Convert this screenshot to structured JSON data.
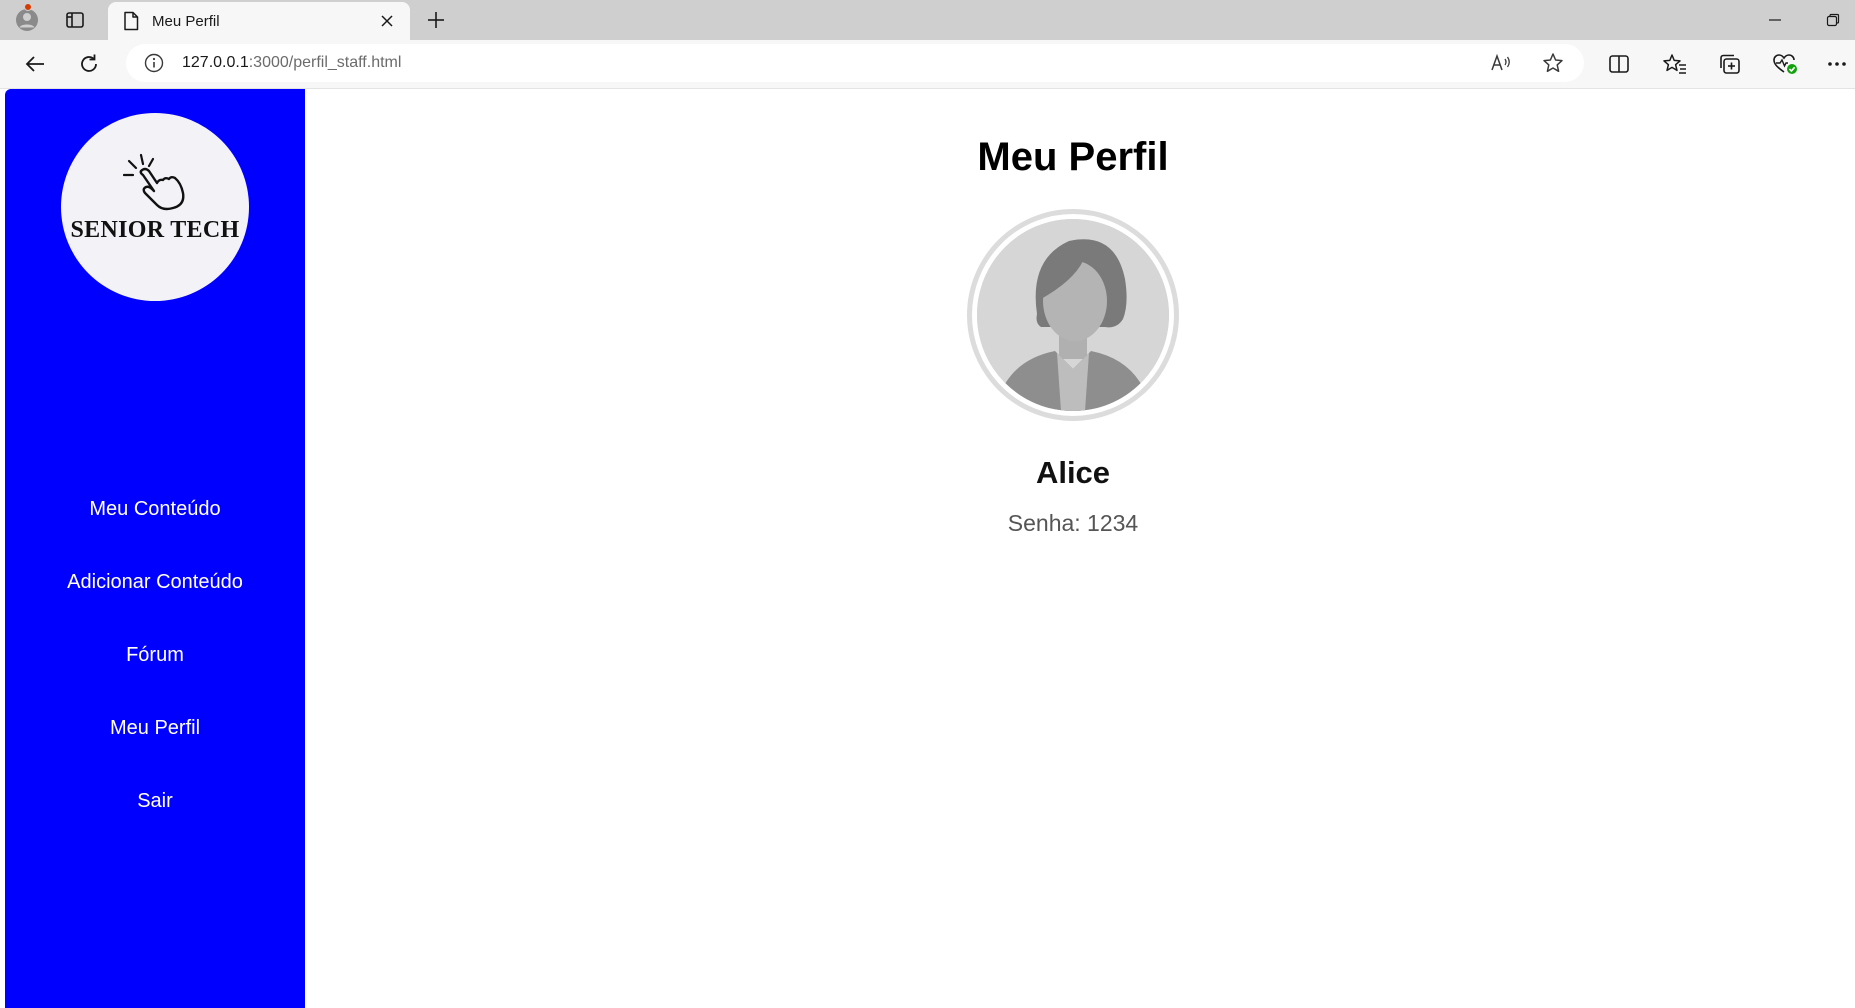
{
  "browser": {
    "tab": {
      "title": "Meu Perfil"
    },
    "address": {
      "host": "127.0.0.1",
      "path": ":3000/perfil_staff.html"
    }
  },
  "sidebar": {
    "logo_text": "SENIOR TECH",
    "nav": [
      {
        "label": "Meu Conteúdo"
      },
      {
        "label": "Adicionar Conteúdo"
      },
      {
        "label": "Fórum"
      },
      {
        "label": "Meu Perfil"
      },
      {
        "label": "Sair"
      }
    ]
  },
  "profile": {
    "title": "Meu Perfil",
    "name": "Alice",
    "password_line": "Senha: 1234"
  },
  "colors": {
    "sidebar": "#0000ff",
    "tabstrip": "#cfcfcf",
    "toolbar": "#f7f7f7"
  },
  "icons": {
    "profile": "profile-icon",
    "tab_actions": "tab-actions-icon",
    "page": "page-icon",
    "close": "close-icon",
    "new_tab": "plus-icon",
    "back": "back-arrow-icon",
    "refresh": "refresh-icon",
    "info": "info-icon",
    "read_aloud": "read-aloud-icon",
    "favorite": "star-icon",
    "split": "split-screen-icon",
    "favorites": "favorites-icon",
    "collections": "collections-icon",
    "browser_essentials": "heart-pulse-icon",
    "more": "more-icon"
  }
}
